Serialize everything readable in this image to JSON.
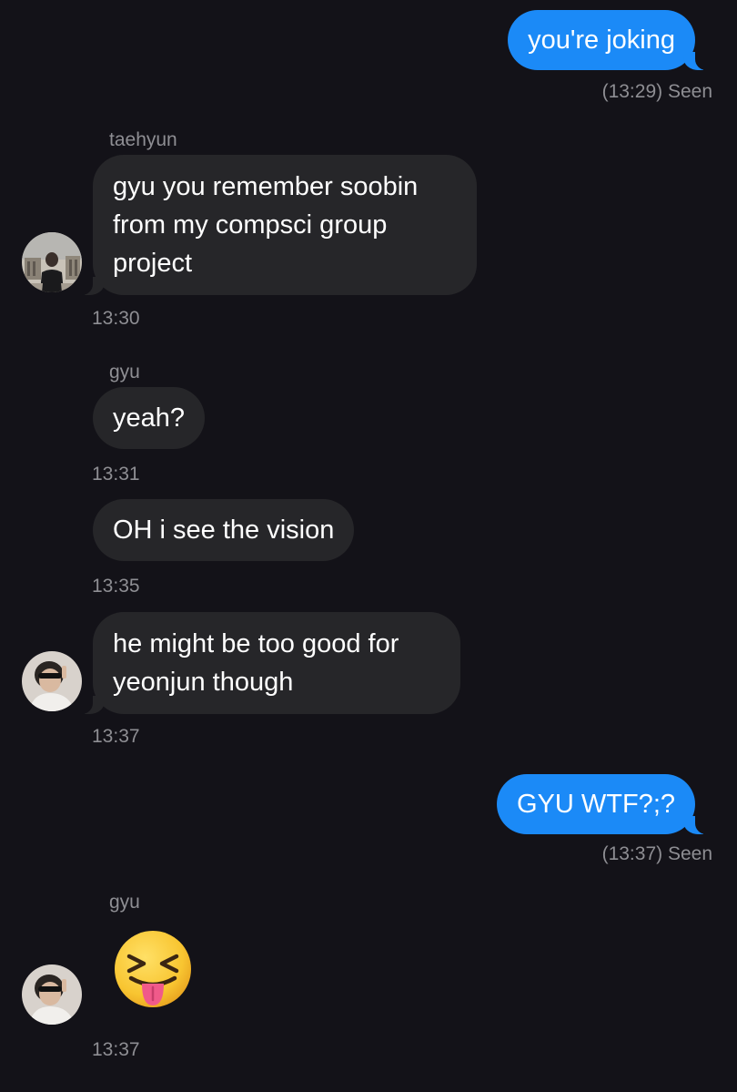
{
  "messages": {
    "m1": {
      "text": "you're joking",
      "status": "(13:29) Seen"
    },
    "m2": {
      "sender": "taehyun",
      "text": "gyu you remember soobin from my compsci group project",
      "time": "13:30"
    },
    "m3": {
      "sender": "gyu",
      "text": "yeah?",
      "time": "13:31"
    },
    "m4": {
      "text": "OH i see the vision",
      "time": "13:35"
    },
    "m5": {
      "text": "he might be too good for yeonjun though",
      "time": "13:37"
    },
    "m6": {
      "text": "GYU WTF?;?",
      "status": "(13:37) Seen"
    },
    "m7": {
      "sender": "gyu",
      "emoji": "squinting-face-with-tongue",
      "time": "13:37"
    }
  },
  "colors": {
    "background": "#131218",
    "incoming_bubble": "#262629",
    "outgoing_bubble": "#1b8af7",
    "meta_text": "#8e8e93"
  },
  "avatars": {
    "taehyun": "avatar-photo-icon",
    "gyu": "avatar-photo-icon"
  }
}
